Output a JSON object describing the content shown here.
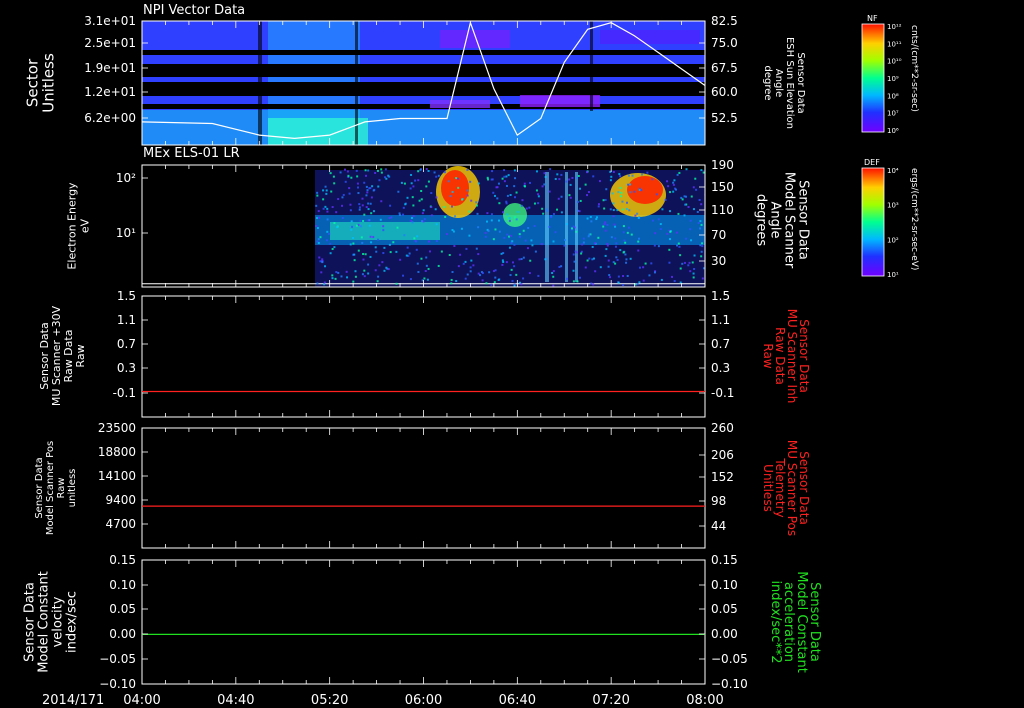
{
  "date_label": "2014/171",
  "time_ticks": [
    "04:00",
    "04:40",
    "05:20",
    "06:00",
    "06:40",
    "07:20",
    "08:00"
  ],
  "chart_data": [
    {
      "type": "heatmap",
      "title": "NPI Vector Data",
      "ylabel_left": [
        "Sector",
        "Unitless"
      ],
      "left_ticks": [
        "3.1e+01",
        "2.5e+01",
        "1.9e+01",
        "1.2e+01",
        "6.2e+00"
      ],
      "ylabel_right": [
        "Sensor Data",
        "ESH Sun Elevation",
        "Angle",
        "degree"
      ],
      "right_ticks": [
        "82.5",
        "75.0",
        "67.5",
        "60.0",
        "52.5"
      ],
      "right_ylim": [
        45,
        82.5
      ],
      "colorbar": {
        "label": "NF",
        "units": "cnts/(cm**2-sr-sec)",
        "ticks": [
          "10¹²",
          "10¹¹",
          "10¹⁰",
          "10⁹",
          "10⁸",
          "10⁷",
          "10⁶"
        ]
      },
      "overlay_line": {
        "color": "#ffffff",
        "x": [
          "04:00",
          "04:30",
          "04:50",
          "05:05",
          "05:20",
          "05:35",
          "05:50",
          "06:10",
          "06:20",
          "06:30",
          "06:40",
          "06:50",
          "07:00",
          "07:10",
          "07:20",
          "07:30",
          "07:40",
          "08:00"
        ],
        "values": [
          52,
          51.5,
          48,
          47,
          48,
          52,
          53,
          53,
          82,
          62,
          48,
          53,
          70,
          80,
          82,
          78,
          73,
          63
        ]
      }
    },
    {
      "type": "heatmap",
      "title": "MEx ELS-01 LR",
      "ylabel_left": [
        "Electron Energy",
        "eV"
      ],
      "left_ticks": [
        "10²",
        "10¹"
      ],
      "ylabel_right": [
        "Sensor Data",
        "Model Scanner",
        "Angle",
        "degrees"
      ],
      "right_ticks": [
        "190",
        "150",
        "110",
        "70",
        "30"
      ],
      "right_ylim": [
        0,
        190
      ],
      "colorbar": {
        "label": "DEF",
        "units": "ergs/(cm**2-sr-sec-eV)",
        "ticks": [
          "10⁴",
          "10³",
          "10²",
          "10¹"
        ]
      },
      "overlay_line": {
        "color": "#ffffff",
        "x": [
          "04:00",
          "08:00"
        ],
        "values": [
          5,
          5
        ]
      }
    },
    {
      "type": "line",
      "ylabel_left": [
        "Sensor Data",
        "MU Scanner +30V",
        "Raw Data",
        "Raw"
      ],
      "left_ticks": [
        "1.5",
        "1.1",
        "0.7",
        "0.3",
        "-0.1"
      ],
      "ylim": [
        -0.4,
        1.5
      ],
      "ylabel_right": [
        "Sensor Data",
        "MU Scanner Inh",
        "Raw Data",
        "Raw"
      ],
      "right_ticks": [
        "1.5",
        "1.1",
        "0.7",
        "0.3",
        "-0.1"
      ],
      "series": [
        {
          "color": "#ff2020",
          "x": [
            "04:00",
            "08:00"
          ],
          "values": [
            0,
            0
          ]
        }
      ]
    },
    {
      "type": "line",
      "ylabel_left": [
        "Sensor Data",
        "Model Scanner Pos",
        "Raw",
        "unitless"
      ],
      "left_ticks": [
        "23500",
        "18800",
        "14100",
        "9400",
        "4700"
      ],
      "ylim": [
        0,
        23500
      ],
      "ylabel_right": [
        "Sensor Data",
        "MU Scanner Pos",
        "Telemetry",
        "Unitless"
      ],
      "right_ticks": [
        "260",
        "206",
        "152",
        "98",
        "44"
      ],
      "series": [
        {
          "color": "#ff2020",
          "x": [
            "04:00",
            "08:00"
          ],
          "values": [
            8200,
            8200
          ]
        }
      ]
    },
    {
      "type": "line",
      "ylabel_left": [
        "Sensor Data",
        "Model Constant",
        "velocity",
        "index/sec"
      ],
      "left_ticks": [
        "0.15",
        "0.10",
        "0.05",
        "0.00",
        "−0.05",
        "−0.10"
      ],
      "ylim": [
        -0.1,
        0.15
      ],
      "ylabel_right": [
        "Sensor Data",
        "Model Constant",
        "acceleration",
        "index/sec**2"
      ],
      "right_ticks": [
        "0.15",
        "0.10",
        "0.05",
        "0.00",
        "−0.05",
        "−0.10"
      ],
      "series": [
        {
          "color": "#20e020",
          "x": [
            "04:00",
            "08:00"
          ],
          "values": [
            0,
            0
          ]
        }
      ]
    }
  ],
  "colors": {
    "right_label_panel3": "#ff2020",
    "right_label_panel4": "#ff2020",
    "right_label_panel5": "#20e020"
  }
}
